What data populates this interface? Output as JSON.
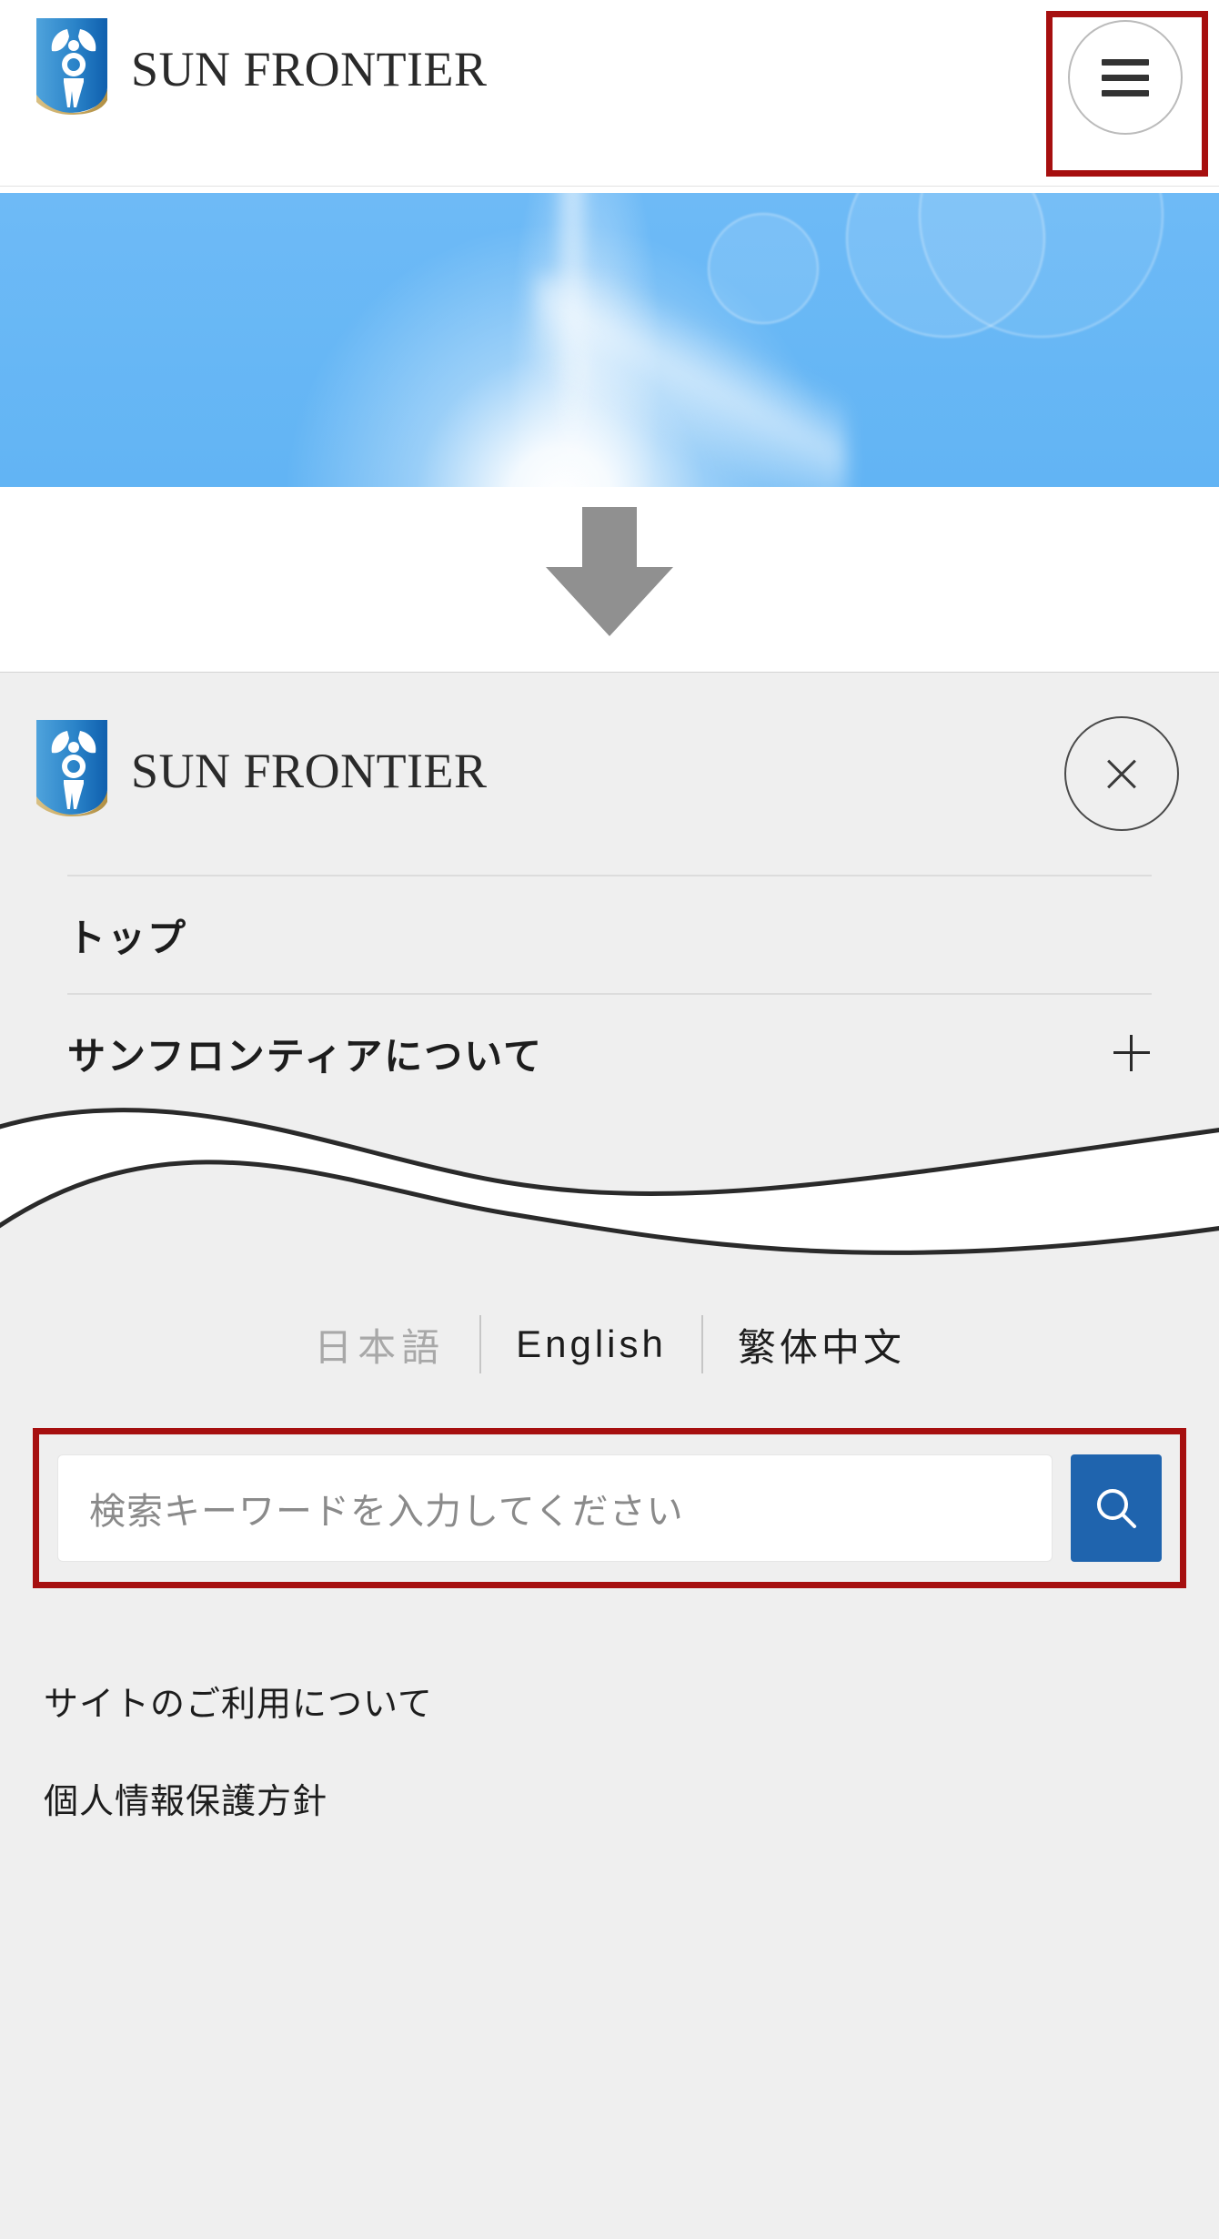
{
  "brand": {
    "name": "SUN FRONTIER",
    "mark_colors": {
      "blue_dark": "#1266b3",
      "blue_light": "#64aee0",
      "gold": "#c9a961"
    }
  },
  "colors": {
    "highlight_red": "#a60f0f",
    "search_button_blue": "#1f64ae",
    "panel_bg": "#efefef",
    "arrow_gray": "#909090",
    "hero_blue": "#67b7f5"
  },
  "topbar": {
    "logo_text": "SUN FRONTIER",
    "menu_button_label": "menu"
  },
  "hero": {
    "alt": "blue sky with sun flare"
  },
  "transition": {
    "arrow_label": "down-arrow"
  },
  "panel": {
    "logo_text": "SUN FRONTIER",
    "close_label": "close",
    "items": [
      {
        "label": "トップ",
        "has_expander": false,
        "expander": ""
      },
      {
        "label": "サンフロンティアについて",
        "has_expander": true,
        "expander": "+"
      }
    ],
    "languages": [
      {
        "label": "日本語",
        "active": true
      },
      {
        "label": "English",
        "active": false
      },
      {
        "label": "繁体中文",
        "active": false
      }
    ],
    "search": {
      "placeholder": "検索キーワードを入力してください",
      "value": "",
      "button_label": "search"
    },
    "footer_links": [
      {
        "label": "サイトのご利用について"
      },
      {
        "label": "個人情報保護方針"
      }
    ]
  }
}
